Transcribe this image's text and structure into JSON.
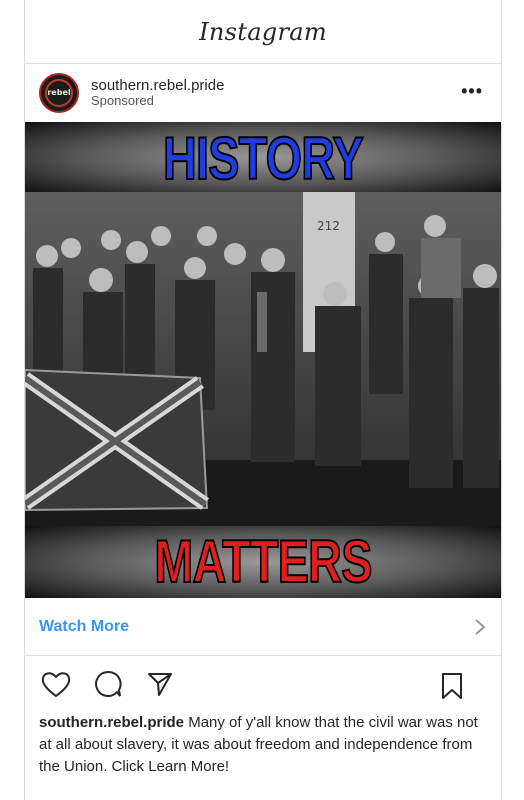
{
  "app": {
    "title": "Instagram"
  },
  "post": {
    "username": "southern.rebel.pride",
    "label": "Sponsored",
    "avatar_text": "rebel",
    "more_icon": "more-horizontal-icon",
    "media": {
      "headline_top": "HISTORY",
      "headline_bottom": "MATTERS",
      "headline_top_color": "#1f3de0",
      "headline_bottom_color": "#e0201f"
    },
    "cta": {
      "label": "Watch More",
      "color": "#3897f0"
    },
    "actions": [
      "heart-icon",
      "comment-icon",
      "share-icon",
      "bookmark-icon"
    ],
    "caption": {
      "username": "southern.rebel.pride",
      "text": "Many of y'all know that the civil war was not at all about slavery, it was about freedom and independence from the Union. Click Learn More!"
    }
  }
}
